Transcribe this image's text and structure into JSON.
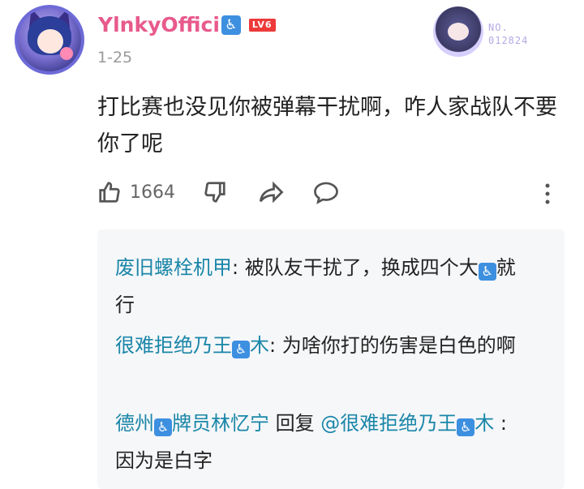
{
  "comment": {
    "author": {
      "name": "YlnkyOffici",
      "name_icon": "accessibility-icon",
      "name_icon_glyph": "♿",
      "level": "LV6",
      "name_color": "#e85a8c"
    },
    "date": "1-25",
    "badge": {
      "label": "NO.",
      "number": "012824"
    },
    "text": "打比赛也没见你被弹幕干扰啊，咋人家战队不要你了呢",
    "actions": {
      "like_count": "1664"
    }
  },
  "replies": [
    {
      "nick": "废旧螺栓机甲",
      "sep": ": ",
      "text_a": "被队友干扰了，换成四个大",
      "icon_glyph": "♿",
      "text_b": "就行"
    },
    {
      "nick_a": "很难拒绝乃王",
      "icon_glyph": "♿",
      "nick_b": "木",
      "sep": ": ",
      "text": "为啥你打的伤害是白色的啊"
    },
    {
      "nick_a": "德州",
      "icon_glyph": "♿",
      "nick_b": "牌员林忆宁",
      "reply_word": " 回复 ",
      "mention_a": "@很难拒绝乃王",
      "mention_b": "木",
      "text": " :因为是白字"
    }
  ],
  "colors": {
    "accent": "#1a86a8",
    "icon_blue": "#3d8fe0"
  }
}
